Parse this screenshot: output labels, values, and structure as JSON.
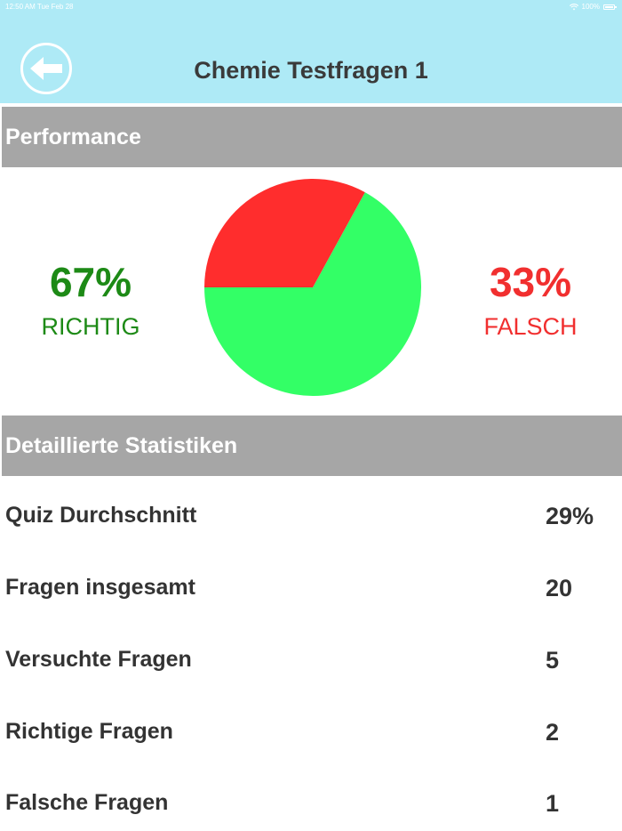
{
  "status_bar": {
    "time_date": "12:50 AM  Tue Feb 28",
    "battery": "100%"
  },
  "header": {
    "title": "Chemie Testfragen 1"
  },
  "performance": {
    "section_title": "Performance",
    "correct": {
      "percent": "67%",
      "label": "RICHTIG",
      "color": "#1d8a16"
    },
    "wrong": {
      "percent": "33%",
      "label": "FALSCH",
      "color": "#f12f2f"
    }
  },
  "chart_data": {
    "type": "pie",
    "slices": [
      {
        "label": "RICHTIG",
        "value": 67,
        "color": "#33ff66"
      },
      {
        "label": "FALSCH",
        "value": 33,
        "color": "#ff2d2d"
      }
    ]
  },
  "stats": {
    "section_title": "Detaillierte Statistiken",
    "rows": [
      {
        "label": "Quiz Durchschnitt",
        "value": "29%"
      },
      {
        "label": "Fragen insgesamt",
        "value": "20"
      },
      {
        "label": "Versuchte Fragen",
        "value": "5"
      },
      {
        "label": "Richtige Fragen",
        "value": "2"
      },
      {
        "label": "Falsche Fragen",
        "value": "1"
      }
    ]
  }
}
